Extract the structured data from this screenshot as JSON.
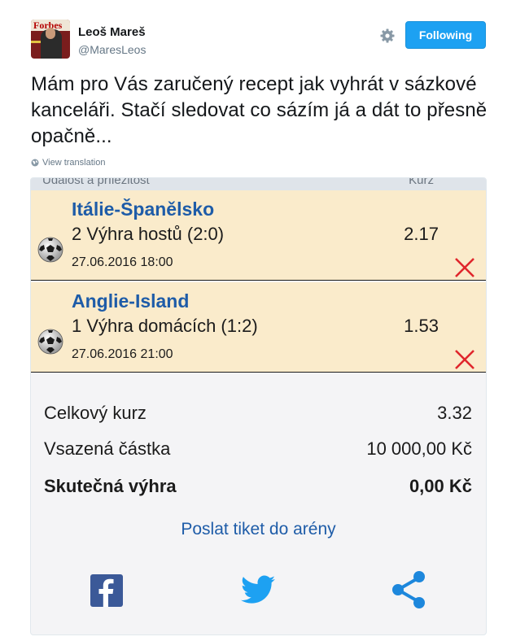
{
  "tweet": {
    "author_name": "Leoš Mareš",
    "author_handle": "@MaresLeos",
    "follow_label": "Following",
    "text": "Mám pro Vás zaručený recept jak vyhrát v sázkové kanceláři. Stačí sledovat co sázím já a dát to přesně opačně...",
    "translate_label": "View translation",
    "avatar_text": "Forbes"
  },
  "ticket": {
    "header_left": "Událost a příležitost",
    "header_right": "Kurz",
    "bets": [
      {
        "match": "Itálie-Španělsko",
        "pick": "2  Výhra hostů (2:0)",
        "date": "27.06.2016 18:00",
        "odds": "2.17"
      },
      {
        "match": "Anglie-Island",
        "pick": "1  Výhra domácích (1:2)",
        "date": "27.06.2016 21:00",
        "odds": "1.53"
      }
    ],
    "summary": {
      "total_odds_label": "Celkový kurz",
      "total_odds_value": "3.32",
      "stake_label": "Vsazená částka",
      "stake_value": "10 000,00 Kč",
      "win_label": "Skutečná výhra",
      "win_value": "0,00 Kč"
    },
    "send_label": "Poslat tiket do arény"
  },
  "colors": {
    "follow_button": "#1da1f2",
    "bet_background": "#faebcb",
    "match_title": "#1e5ca8",
    "cross": "#e0262c",
    "facebook": "#3b5998",
    "twitter": "#1da1f2"
  },
  "icons": [
    "gear-icon",
    "globe-icon",
    "soccer-ball-icon",
    "cross-icon",
    "facebook-icon",
    "twitter-icon",
    "share-icon"
  ]
}
